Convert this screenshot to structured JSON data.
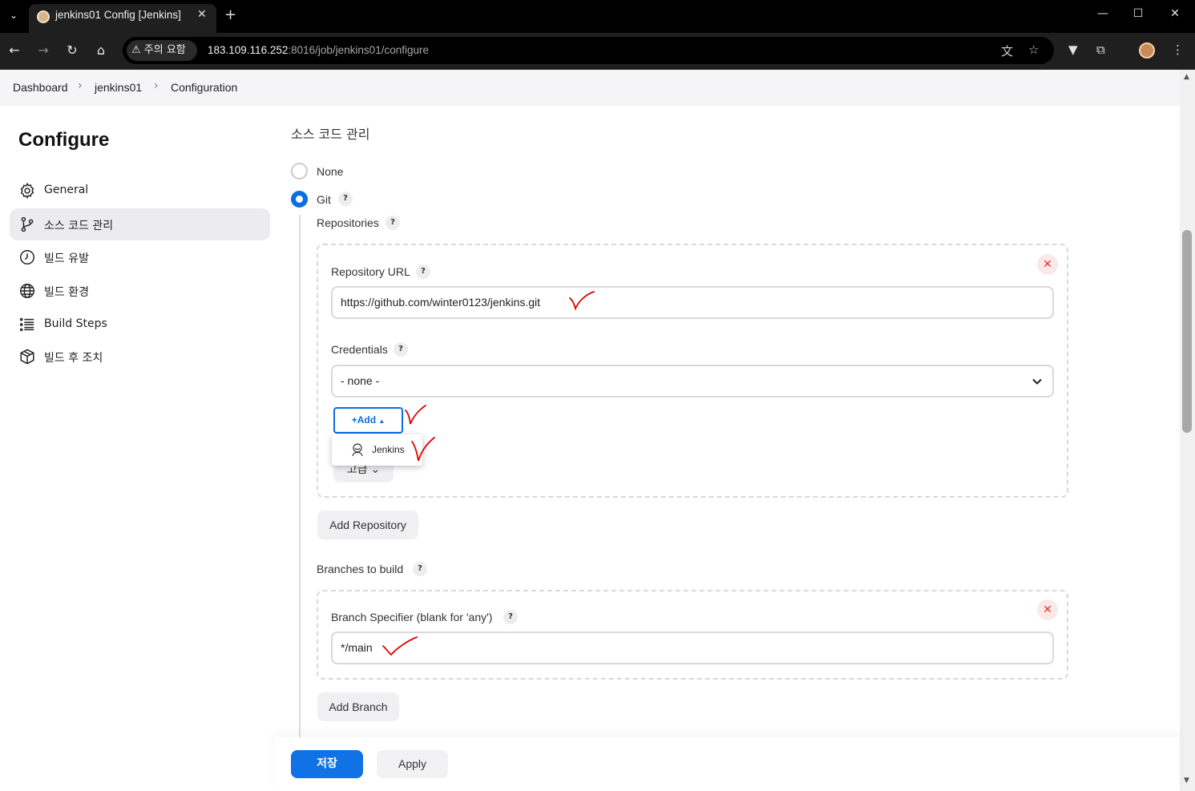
{
  "browser": {
    "tab_title": "jenkins01 Config [Jenkins]",
    "security_chip": "⚠ 주의 요함",
    "url_host": "183.109.116.252",
    "url_rest": ":8016/job/jenkins01/configure"
  },
  "breadcrumb": {
    "items": [
      "Dashboard",
      "jenkins01",
      "Configuration"
    ]
  },
  "sidebar": {
    "title": "Configure",
    "items": [
      {
        "label": "General",
        "icon": "gear-icon"
      },
      {
        "label": "소스 코드 관리",
        "icon": "git-branch-icon"
      },
      {
        "label": "빌드 유발",
        "icon": "clock-icon"
      },
      {
        "label": "빌드 환경",
        "icon": "globe-icon"
      },
      {
        "label": "Build Steps",
        "icon": "list-icon"
      },
      {
        "label": "빌드 후 조치",
        "icon": "package-icon"
      }
    ],
    "active_index": 1
  },
  "scm": {
    "section_title": "소스 코드 관리",
    "option_none": "None",
    "option_git": "Git",
    "selected": "Git",
    "repositories_label": "Repositories",
    "repo_url_label": "Repository URL",
    "repo_url_value": "https://github.com/winter0123/jenkins.git",
    "credentials_label": "Credentials",
    "credentials_value": "- none -",
    "add_button": "Add",
    "add_menu_item": "Jenkins",
    "advanced_button": "고급",
    "add_repository_button": "Add Repository",
    "branches_label": "Branches to build",
    "branch_specifier_label": "Branch Specifier (blank for 'any')",
    "branch_specifier_value": "*/main",
    "add_branch_button": "Add Branch",
    "help_glyph": "?"
  },
  "footer": {
    "save_button": "저장",
    "apply_button": "Apply"
  },
  "colors": {
    "accent": "#0b6ddf",
    "save": "#1072e5",
    "annotation": "#e00000"
  }
}
